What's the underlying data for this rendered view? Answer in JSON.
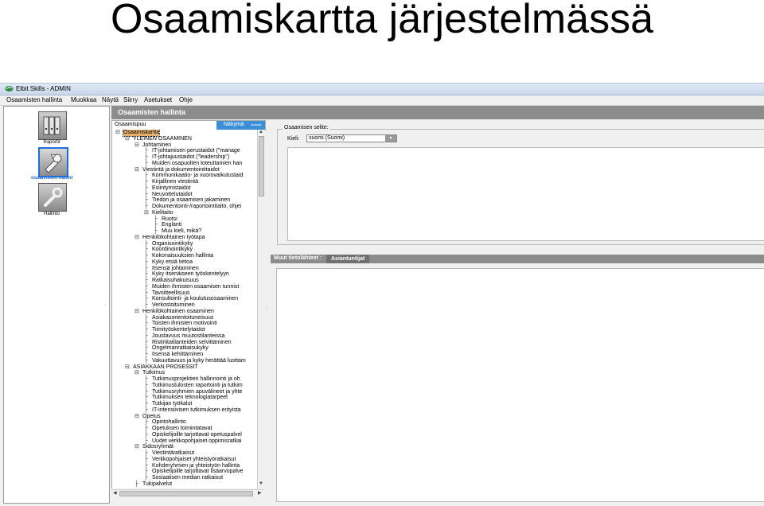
{
  "slide": {
    "title": "Osaamiskartta järjestelmässä"
  },
  "window": {
    "title": "Elbit Skills - ADMIN"
  },
  "menu": [
    "Osaamisten hallinta",
    "Muokkaa",
    "Näytä",
    "Siirry",
    "Asetukset",
    "Ohje"
  ],
  "nav": [
    {
      "label": "Raportit",
      "icon": "reports-icon",
      "active": false
    },
    {
      "label": "osaamisten hallint",
      "icon": "skills-management-icon",
      "active": true
    },
    {
      "label": "Hallinto",
      "icon": "administration-icon",
      "active": false
    }
  ],
  "module": {
    "title": "Osaamisten hallinta"
  },
  "tree_panel": {
    "header": "Osaamispuu",
    "view_button": "Näkymä"
  },
  "tree": [
    {
      "d": 0,
      "t": "Osaamiskartta",
      "sel": true
    },
    {
      "d": 1,
      "t": "YLEINEN OSAAMINEN"
    },
    {
      "d": 2,
      "t": "Johtaminen"
    },
    {
      "d": 3,
      "t": "IT-johtamisen perustaidot (\"manage"
    },
    {
      "d": 3,
      "t": "IT-johtajuustaidot (\"leadership\")"
    },
    {
      "d": 3,
      "t": "Muiden osapuolten toteuttamien han"
    },
    {
      "d": 2,
      "t": "Viestintä ja dokumentointitaidot"
    },
    {
      "d": 3,
      "t": "Kommunikaatio- ja vuorovaikutustaid"
    },
    {
      "d": 3,
      "t": "Kirjallinen viestintä"
    },
    {
      "d": 3,
      "t": "Esiintymistaidot"
    },
    {
      "d": 3,
      "t": "Neuvottelutaidot"
    },
    {
      "d": 3,
      "t": "Tiedon ja osaamisen jakaminen"
    },
    {
      "d": 3,
      "t": "Dokumentointi-/raportointitaito, ohjei"
    },
    {
      "d": 3,
      "t": "Kielitaito"
    },
    {
      "d": 4,
      "t": "Ruotsi"
    },
    {
      "d": 4,
      "t": "Englanti"
    },
    {
      "d": 4,
      "t": "Muu kieli, mikä?"
    },
    {
      "d": 2,
      "t": "Henkilökohtainen työtapa"
    },
    {
      "d": 3,
      "t": "Organisointikyky"
    },
    {
      "d": 3,
      "t": "Koordinointikyky"
    },
    {
      "d": 3,
      "t": "Kokonaisuuksien hallinta"
    },
    {
      "d": 3,
      "t": "Kyky etsiä tietoa"
    },
    {
      "d": 3,
      "t": "Itsensä johtaminen"
    },
    {
      "d": 3,
      "t": "Kyky itsenäiseen työskentelyyn"
    },
    {
      "d": 3,
      "t": "Ratkaisuhakuisuus"
    },
    {
      "d": 3,
      "t": "Muiden ihmisten osaamisen tunnist"
    },
    {
      "d": 3,
      "t": "Tavoitteellisuus"
    },
    {
      "d": 3,
      "t": "Konsultointi- ja koulutusosaaminen"
    },
    {
      "d": 3,
      "t": "Verkostoituminen"
    },
    {
      "d": 2,
      "t": "Henkilökohtainen osaaminen"
    },
    {
      "d": 3,
      "t": "Asiakasorientoituneisuus"
    },
    {
      "d": 3,
      "t": "Toisten ihmisten motivointi"
    },
    {
      "d": 3,
      "t": "Tiimityöskentelytaidot"
    },
    {
      "d": 3,
      "t": "Joustavuus muutostilanteissa"
    },
    {
      "d": 3,
      "t": "Ristiriitatilanteiden selvittäminen"
    },
    {
      "d": 3,
      "t": "Ongelmanratkaisukyky"
    },
    {
      "d": 3,
      "t": "Itsensä kehittäminen"
    },
    {
      "d": 3,
      "t": "Vakuuttavuus ja kyky herättää luottam"
    },
    {
      "d": 1,
      "t": "ASIAKKAAN PROSESSIT"
    },
    {
      "d": 2,
      "t": "Tutkimus"
    },
    {
      "d": 3,
      "t": "Tutkimusprojektien hallinnointi ja oh"
    },
    {
      "d": 3,
      "t": "Tutkimustulosten raportointi ja tutkim"
    },
    {
      "d": 3,
      "t": "Tutkimusryhmien apuvälineet ja yhte"
    },
    {
      "d": 3,
      "t": "Tutkimuksen teknologiatarpeet"
    },
    {
      "d": 3,
      "t": "Tutkijan työkalut"
    },
    {
      "d": 3,
      "t": "IT-intensiivisen tutkimuksen erityista"
    },
    {
      "d": 2,
      "t": "Opetus"
    },
    {
      "d": 3,
      "t": "Opintohallinto"
    },
    {
      "d": 3,
      "t": "Opetuksen toimintatavat"
    },
    {
      "d": 3,
      "t": "Opiskelijoille tarjottavat opetuspalvel"
    },
    {
      "d": 3,
      "t": "Uudet verkkopohjaiset oppimisratkai"
    },
    {
      "d": 2,
      "t": "Sidosryhmät"
    },
    {
      "d": 3,
      "t": "Viestintäratkaisut"
    },
    {
      "d": 3,
      "t": "Verkkopohjaiset yhteistyöratkaisut"
    },
    {
      "d": 3,
      "t": "Kohderyhmien ja yhteistyön hallinta"
    },
    {
      "d": 3,
      "t": "Opiskelijoille tarjottavat lisäarvopalve"
    },
    {
      "d": 3,
      "t": "Sosiaalisen median ratkaisut"
    },
    {
      "d": 2,
      "t": "Tukipalvelut"
    }
  ],
  "description": {
    "legend": "Osaamisen selite:",
    "language_label": "Kieli:",
    "language_value": "suomi (Suomi)"
  },
  "other_info": {
    "header": "Muut tietolähteet :",
    "tab": "Asiantuntijat"
  }
}
